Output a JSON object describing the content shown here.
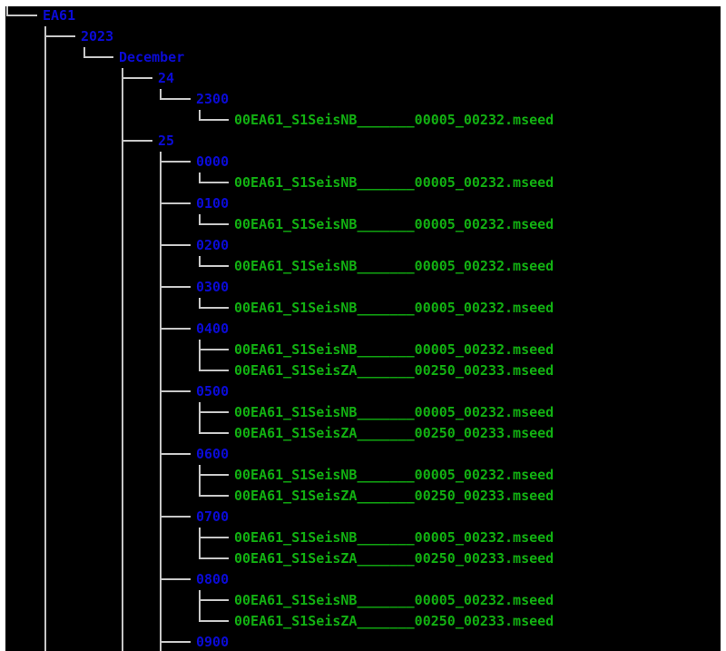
{
  "tree": {
    "root": "EA61",
    "year": "2023",
    "month": "December",
    "days": [
      {
        "day": "24",
        "hours": [
          {
            "hour": "2300",
            "files": [
              "00EA61_S1SeisNB_______00005_00232.mseed"
            ]
          }
        ]
      },
      {
        "day": "25",
        "hours": [
          {
            "hour": "0000",
            "files": [
              "00EA61_S1SeisNB_______00005_00232.mseed"
            ]
          },
          {
            "hour": "0100",
            "files": [
              "00EA61_S1SeisNB_______00005_00232.mseed"
            ]
          },
          {
            "hour": "0200",
            "files": [
              "00EA61_S1SeisNB_______00005_00232.mseed"
            ]
          },
          {
            "hour": "0300",
            "files": [
              "00EA61_S1SeisNB_______00005_00232.mseed"
            ]
          },
          {
            "hour": "0400",
            "files": [
              "00EA61_S1SeisNB_______00005_00232.mseed",
              "00EA61_S1SeisZA_______00250_00233.mseed"
            ]
          },
          {
            "hour": "0500",
            "files": [
              "00EA61_S1SeisNB_______00005_00232.mseed",
              "00EA61_S1SeisZA_______00250_00233.mseed"
            ]
          },
          {
            "hour": "0600",
            "files": [
              "00EA61_S1SeisNB_______00005_00232.mseed",
              "00EA61_S1SeisZA_______00250_00233.mseed"
            ]
          },
          {
            "hour": "0700",
            "files": [
              "00EA61_S1SeisNB_______00005_00232.mseed",
              "00EA61_S1SeisZA_______00250_00233.mseed"
            ]
          },
          {
            "hour": "0800",
            "files": [
              "00EA61_S1SeisNB_______00005_00232.mseed",
              "00EA61_S1SeisZA_______00250_00233.mseed"
            ]
          },
          {
            "hour": "0900",
            "files": []
          }
        ]
      }
    ]
  },
  "colors": {
    "background": "#000000",
    "directory": "#0b0bd6",
    "file": "#12b012",
    "tree_lines": "#c8c8c8"
  }
}
